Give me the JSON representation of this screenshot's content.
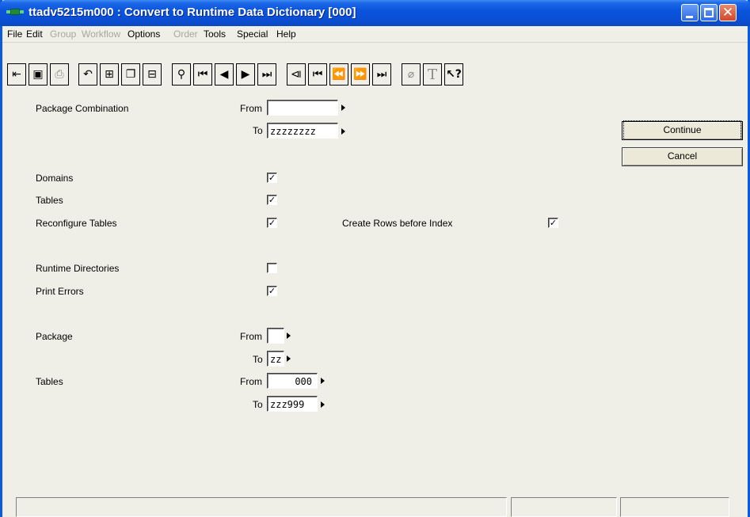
{
  "window": {
    "title": "ttadv5215m000 : Convert to Runtime Data Dictionary [000]"
  },
  "menu": [
    {
      "label": "File",
      "enabled": true
    },
    {
      "label": "Edit",
      "enabled": true
    },
    {
      "label": "Group",
      "enabled": false
    },
    {
      "label": "Workflow",
      "enabled": false
    },
    {
      "label": "Options",
      "enabled": true
    },
    {
      "label": "Order",
      "enabled": false
    },
    {
      "label": "Tools",
      "enabled": true
    },
    {
      "label": "Special",
      "enabled": true
    },
    {
      "label": "Help",
      "enabled": true
    }
  ],
  "toolbar": {
    "icons": [
      "exit-icon",
      "save-icon",
      "print-icon",
      "undo-icon",
      "insert-record-icon",
      "copy-icon",
      "delete-record-icon",
      "find-icon",
      "first-record-icon",
      "previous-record-icon",
      "next-record-icon",
      "last-record-icon",
      "first-set-icon",
      "previous-group-icon",
      "previous-set-icon",
      "next-set-icon",
      "last-group-icon",
      "attachment-icon",
      "text-icon",
      "help-pointer-icon"
    ]
  },
  "form": {
    "package_combination": {
      "label": "Package Combination",
      "from_label": "From",
      "to_label": "To",
      "from_value": "",
      "to_value": "zzzzzzzz"
    },
    "domains": {
      "label": "Domains",
      "checked": true
    },
    "tables": {
      "label": "Tables",
      "checked": true
    },
    "reconfigure_tables": {
      "label": "Reconfigure Tables",
      "checked": true
    },
    "create_rows_before_index": {
      "label": "Create Rows before Index",
      "checked": true
    },
    "runtime_directories": {
      "label": "Runtime Directories",
      "checked": false
    },
    "print_errors": {
      "label": "Print Errors",
      "checked": true
    },
    "package": {
      "label": "Package",
      "from_label": "From",
      "to_label": "To",
      "from_value": "",
      "to_value": "zz"
    },
    "tables_range": {
      "label": "Tables",
      "from_label": "From",
      "to_label": "To",
      "from_value": "000",
      "to_value": "zzz999"
    }
  },
  "buttons": {
    "continue_label": "Continue",
    "cancel_label": "Cancel"
  },
  "check_mark": "✓"
}
